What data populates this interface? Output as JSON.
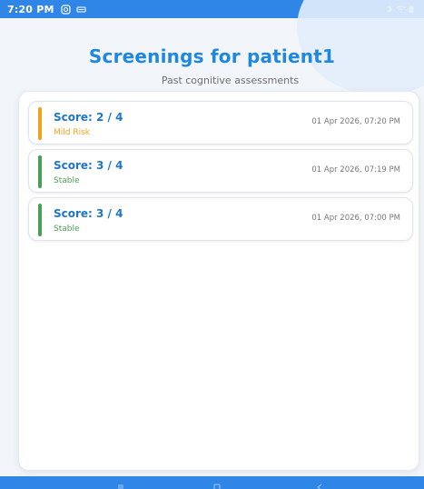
{
  "status_bar": {
    "time": "7:20 PM",
    "left_icons": [
      "instagram-icon",
      "message-icon"
    ],
    "right_icons": [
      "bluetooth-icon",
      "wifi-icon",
      "battery-icon"
    ],
    "color": "#2f86e6"
  },
  "header": {
    "title": "Screenings for patient1",
    "subtitle": "Past cognitive assessments"
  },
  "screenings": [
    {
      "score": "Score: 2 / 4",
      "risk": "Mild Risk",
      "date": "01 Apr 2026, 07:20 PM",
      "color": "#f2a31c"
    },
    {
      "score": "Score: 3 / 4",
      "risk": "Stable",
      "date": "01 Apr 2026, 07:19 PM",
      "color": "#4d9e55"
    },
    {
      "score": "Score: 3 / 4",
      "risk": "Stable",
      "date": "01 Apr 2026, 07:00 PM",
      "color": "#4d9e55"
    }
  ],
  "nav_bar": {
    "icons": [
      "menu-icon",
      "home-icon",
      "back-icon"
    ],
    "color": "#2f86e6"
  }
}
